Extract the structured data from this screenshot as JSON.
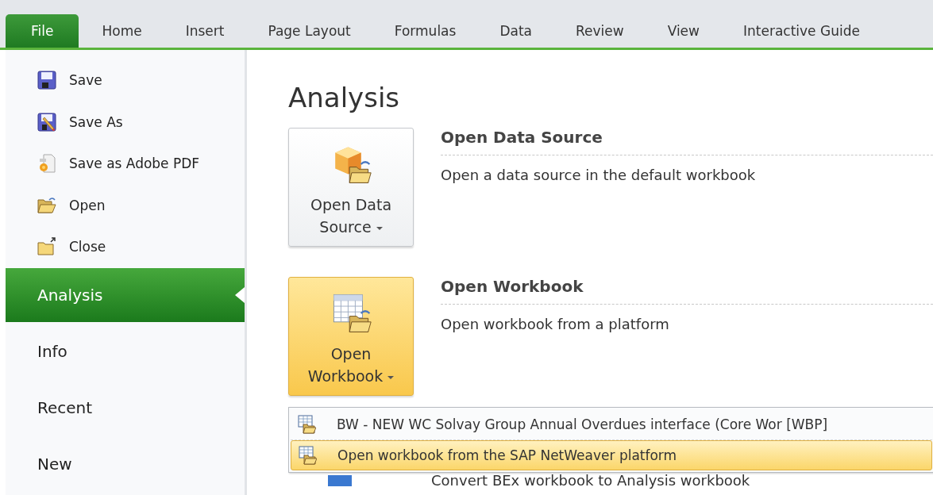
{
  "tabs": [
    {
      "label": "File",
      "selected": true
    },
    {
      "label": "Home",
      "selected": false
    },
    {
      "label": "Insert",
      "selected": false
    },
    {
      "label": "Page Layout",
      "selected": false
    },
    {
      "label": "Formulas",
      "selected": false
    },
    {
      "label": "Data",
      "selected": false
    },
    {
      "label": "Review",
      "selected": false
    },
    {
      "label": "View",
      "selected": false
    },
    {
      "label": "Interactive Guide",
      "selected": false
    }
  ],
  "sidebar": {
    "items": [
      {
        "kind": "command",
        "label": "Save",
        "selected": false
      },
      {
        "kind": "command",
        "label": "Save As",
        "selected": false
      },
      {
        "kind": "command",
        "label": "Save as Adobe PDF",
        "selected": false
      },
      {
        "kind": "command",
        "label": "Open",
        "selected": false
      },
      {
        "kind": "command",
        "label": "Close",
        "selected": false
      },
      {
        "kind": "section",
        "label": "Analysis",
        "selected": true
      },
      {
        "kind": "section",
        "label": "Info",
        "selected": false
      },
      {
        "kind": "section",
        "label": "Recent",
        "selected": false
      },
      {
        "kind": "section",
        "label": "New",
        "selected": false
      }
    ]
  },
  "main": {
    "title": "Analysis",
    "sections": [
      {
        "button": "Open Data Source",
        "highlighted": false,
        "heading": "Open Data Source",
        "description": "Open a data source in the default workbook"
      },
      {
        "button": "Open Workbook",
        "highlighted": true,
        "heading": "Open Workbook",
        "description": "Open workbook from a platform"
      }
    ],
    "covered_text": "Convert BEx workbook to Analysis workbook",
    "menu": [
      {
        "label": "BW - NEW WC Solvay Group Annual Overdues interface (Core Wor [WBP]",
        "selected": false
      },
      {
        "label": "Open workbook from the SAP NetWeaver platform",
        "selected": true
      }
    ]
  }
}
